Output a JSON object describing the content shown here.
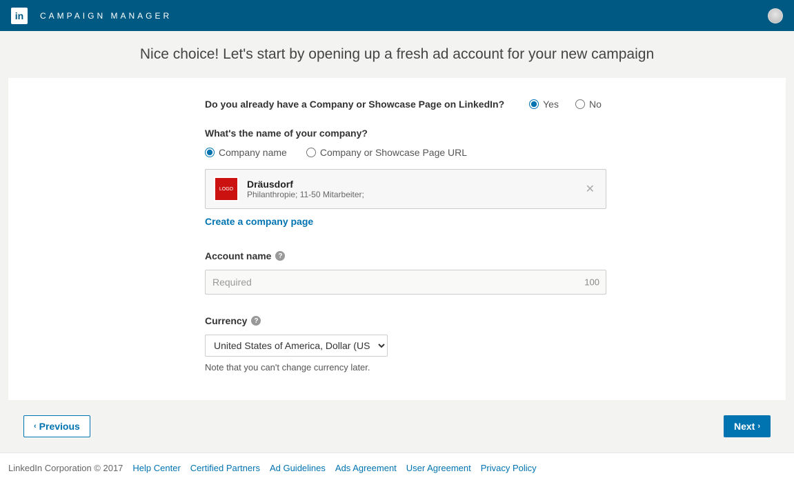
{
  "header": {
    "logo_text": "in",
    "title": "CAMPAIGN MANAGER"
  },
  "page": {
    "heading": "Nice choice! Let's start by opening up a fresh ad account for your new campaign"
  },
  "form": {
    "existing_page_question": "Do you already have a Company or Showcase Page on LinkedIn?",
    "yes": "Yes",
    "no": "No",
    "company_name_question": "What's the name of your company?",
    "option_company_name": "Company name",
    "option_page_url": "Company or Showcase Page URL",
    "selected_company": {
      "name": "Dräusdorf",
      "subtitle": "Philanthropie; 11-50 Mitarbeiter;"
    },
    "create_page_link": "Create a company page",
    "account_name_label": "Account name",
    "account_name_placeholder": "Required",
    "account_name_count": "100",
    "currency_label": "Currency",
    "currency_value": "United States of America, Dollar (USD)",
    "currency_note": "Note that you can't change currency later."
  },
  "nav": {
    "previous": "Previous",
    "next": "Next"
  },
  "footer": {
    "copyright": "LinkedIn Corporation © 2017",
    "links": [
      "Help Center",
      "Certified Partners",
      "Ad Guidelines",
      "Ads Agreement",
      "User Agreement",
      "Privacy Policy"
    ]
  }
}
